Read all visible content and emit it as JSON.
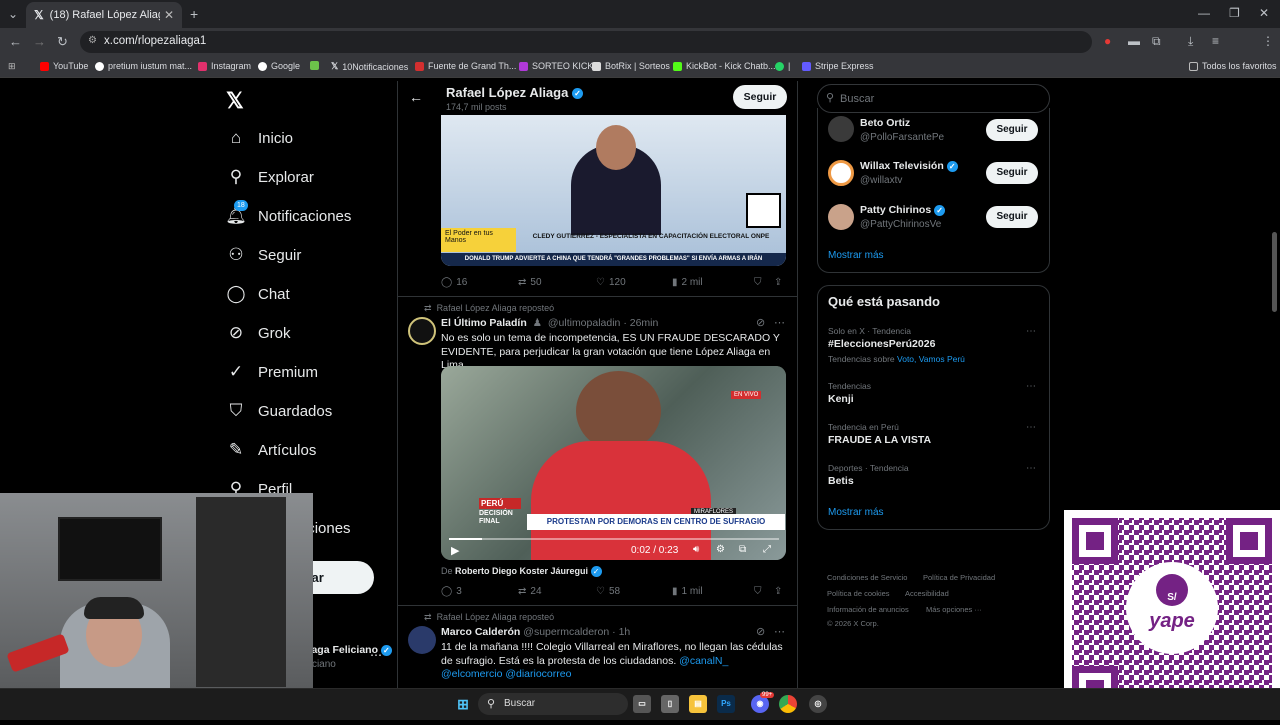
{
  "browser": {
    "tab_title": "(18) Rafael López Aliaga (@rlop",
    "url": "x.com/rlopezaliaga1",
    "bookmarks": [
      "YouTube",
      "pretium iustum mat...",
      "Instagram",
      "Google",
      "10Notificaciones",
      "Fuente de Grand Th...",
      "SORTEO KICK",
      "BotRix | Sorteos",
      "KickBot - Kick Chatb...",
      "|",
      "Stripe Express"
    ],
    "all_bookmarks": "Todos los favoritos"
  },
  "nav": {
    "items": [
      "Inicio",
      "Explorar",
      "Notificaciones",
      "Seguir",
      "Chat",
      "Grok",
      "Premium",
      "Guardados",
      "Artículos",
      "Perfil",
      "Más opciones"
    ],
    "notif_badge": "18",
    "post_button": "Postear",
    "account_name": "Rafael Aliaga Feliciano",
    "account_handle": "@rafaelfeliciano"
  },
  "profile_header": {
    "name": "Rafael López Aliaga",
    "posts": "174,7 mil posts",
    "follow_label": "Seguir"
  },
  "tweets": [
    {
      "image_caption_1": "El Poder en tus Manos",
      "image_caption_2": "CLEDY GUTIERREZ - ESPECIALISTA EN CAPACITACIÓN ELECTORAL ONPE",
      "image_ticker": "DONALD TRUMP ADVIERTE A CHINA QUE TENDRÁ \"GRANDES PROBLEMAS\" SI ENVÍA ARMAS A IRÁN",
      "replies": "16",
      "reposts": "50",
      "likes": "120",
      "views": "2 mil"
    },
    {
      "repost_label": "Rafael López Aliaga reposteó",
      "author": "El Último Paladín",
      "handle": "@ultimopaladin",
      "time": "26min",
      "text": "No es solo un tema de incompetencia, ES UN FRAUDE DESCARADO Y EVIDENTE, para perjudicar la gran votación que tiene López Aliaga en Lima.",
      "video_banner": "PROTESTAN POR DEMORAS EN CENTRO DE SUFRAGIO",
      "video_location": "MIRAFLORES",
      "video_tag_1": "PERÚ",
      "video_tag_2": "DECISIÓN FINAL",
      "video_live": "EN VIVO",
      "video_time": "0:02 / 0:23",
      "attribution_prefix": "De",
      "attribution": "Roberto Diego Koster Jáuregui",
      "replies": "3",
      "reposts": "24",
      "likes": "58",
      "views": "1 mil"
    },
    {
      "repost_label": "Rafael López Aliaga reposteó",
      "author": "Marco Calderón",
      "handle": "@supermcalderon",
      "time": "1h",
      "text_1": "11 de la mañana !!!! Colegio Villarreal en Miraflores, no llegan las cédulas de sufragio. Está es la protesta de los ciudadanos.",
      "mentions": "@canalN_ @elcomercio @diariocorreo"
    }
  ],
  "right": {
    "search_placeholder": "Buscar",
    "who_to_follow": [
      {
        "name": "Beto Ortiz",
        "handle": "@PolloFarsantePe",
        "button": "Seguir"
      },
      {
        "name": "Willax Televisión",
        "handle": "@willaxtv",
        "button": "Seguir"
      },
      {
        "name": "Patty Chirinos",
        "handle": "@PattyChirinosVe",
        "button": "Seguir"
      }
    ],
    "show_more": "Mostrar más",
    "trends_title": "Qué está pasando",
    "trends": [
      {
        "meta": "Solo en X · Tendencia",
        "name": "#EleccionesPerú2026",
        "extra": "Tendencias sobre",
        "extra_links": "Voto, Vamos Perú"
      },
      {
        "meta": "Tendencias",
        "name": "Kenji"
      },
      {
        "meta": "Tendencia en Perú",
        "name": "FRAUDE A LA VISTA"
      },
      {
        "meta": "Deportes · Tendencia",
        "name": "Betis"
      }
    ],
    "trends_more": "Mostrar más",
    "footer": [
      "Condiciones de Servicio",
      "Política de Privacidad",
      "Política de cookies",
      "Accesibilidad",
      "Información de anuncios",
      "Más opciones ···",
      "© 2026 X Corp."
    ]
  },
  "overlay": {
    "qr_brand": "yape",
    "qr_badge": "S/"
  },
  "taskbar": {
    "search": "Buscar",
    "discord_badge": "99+"
  },
  "colors": {
    "accent": "#1d9bf0",
    "yape_purple": "#742284",
    "background": "#000000"
  }
}
